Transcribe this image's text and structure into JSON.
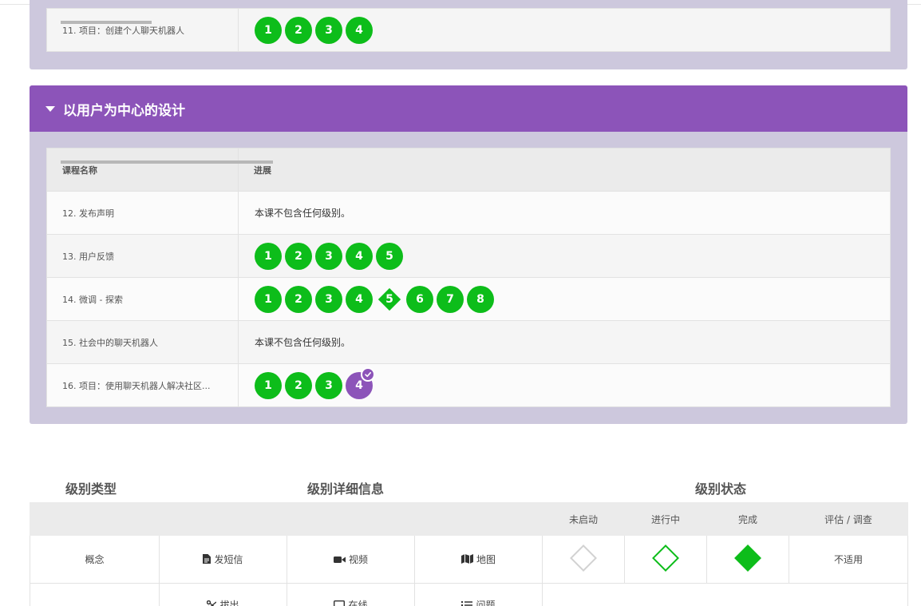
{
  "section1": {
    "lessons": [
      {
        "name": "11. 项目：创建个人聊天机器人",
        "levels": [
          "1",
          "2",
          "3",
          "4"
        ]
      }
    ]
  },
  "section2": {
    "title": "以用户为中心的设计",
    "columns": {
      "name": "课程名称",
      "progress": "进展"
    },
    "lessons": [
      {
        "name": "12. 发布声明",
        "text": "本课不包含任何级别。"
      },
      {
        "name": "13. 用户反馈",
        "levels": [
          "1",
          "2",
          "3",
          "4",
          "5"
        ]
      },
      {
        "name": "14. 微调 - 探索",
        "levels": [
          "1",
          "2",
          "3",
          "4",
          "5",
          "6",
          "7",
          "8"
        ],
        "assessment_level": "5"
      },
      {
        "name": "15. 社会中的聊天机器人",
        "text": "本课不包含任何级别。"
      },
      {
        "name": "16. 项目：使用聊天机器人解决社区...",
        "levels": [
          "1",
          "2",
          "3",
          "4"
        ],
        "current_level": "4"
      }
    ]
  },
  "key": {
    "headings": {
      "type": "级别类型",
      "details": "级别详细信息",
      "status": "级别状态"
    },
    "status_columns": [
      "未启动",
      "进行中",
      "完成",
      "评估 / 调查"
    ],
    "rows": [
      {
        "type": "概念",
        "details": [
          {
            "icon": "document-icon",
            "label": "发短信"
          },
          {
            "icon": "video-icon",
            "label": "视频"
          },
          {
            "icon": "map-icon",
            "label": "地图"
          }
        ],
        "assessment": "不适用"
      },
      {
        "type": "",
        "details": [
          {
            "icon": "scissors-icon",
            "label": "拔出"
          },
          {
            "icon": "monitor-icon",
            "label": "在线"
          },
          {
            "icon": "list-icon",
            "label": "问题"
          }
        ]
      }
    ]
  },
  "colors": {
    "level": "#0dbd1a",
    "section": "#8c54b9",
    "section_bg": "#cdc8dd"
  }
}
